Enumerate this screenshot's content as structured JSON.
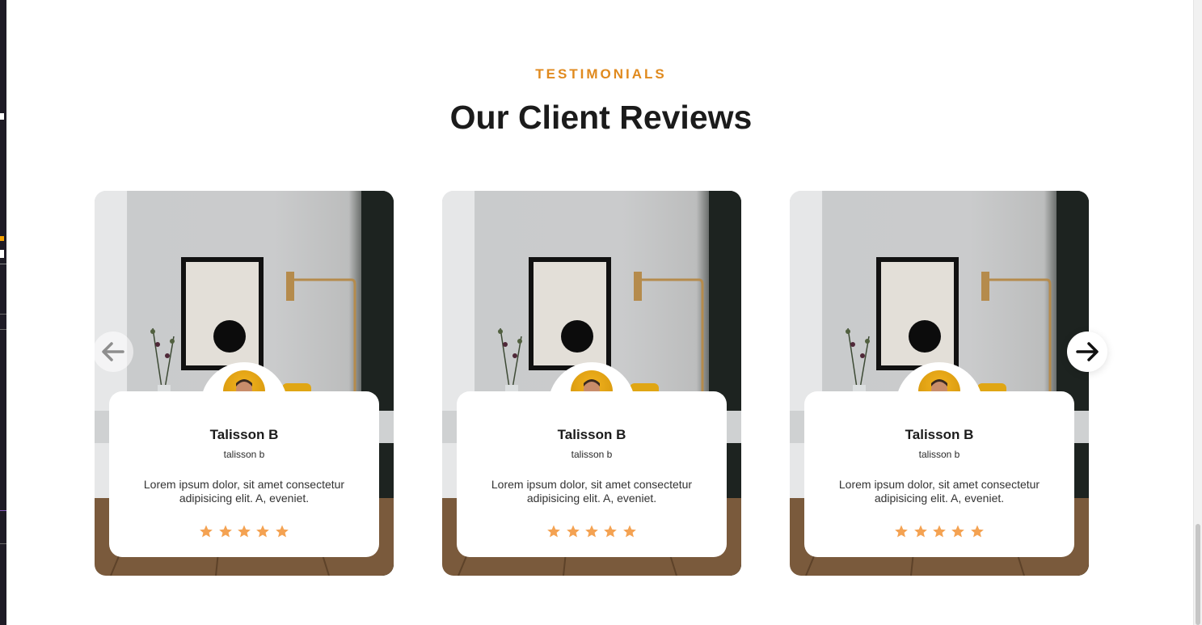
{
  "section": {
    "eyebrow": "TESTIMONIALS",
    "title": "Our Client Reviews"
  },
  "carousel": {
    "prev_icon": "arrow-left-icon",
    "next_icon": "arrow-right-icon"
  },
  "testimonials": [
    {
      "name": "Talisson B",
      "handle": "talisson b",
      "text": "Lorem ipsum dolor, sit amet consectetur adipisicing elit. A, eveniet.",
      "rating": 5
    },
    {
      "name": "Talisson B",
      "handle": "talisson b",
      "text": "Lorem ipsum dolor, sit amet consectetur adipisicing elit. A, eveniet.",
      "rating": 5
    },
    {
      "name": "Talisson B",
      "handle": "talisson b",
      "text": "Lorem ipsum dolor, sit amet consectetur adipisicing elit. A, eveniet.",
      "rating": 5
    }
  ],
  "colors": {
    "accent": "#e08a1e",
    "star": "#f4a252",
    "heading": "#1b1b1b"
  }
}
